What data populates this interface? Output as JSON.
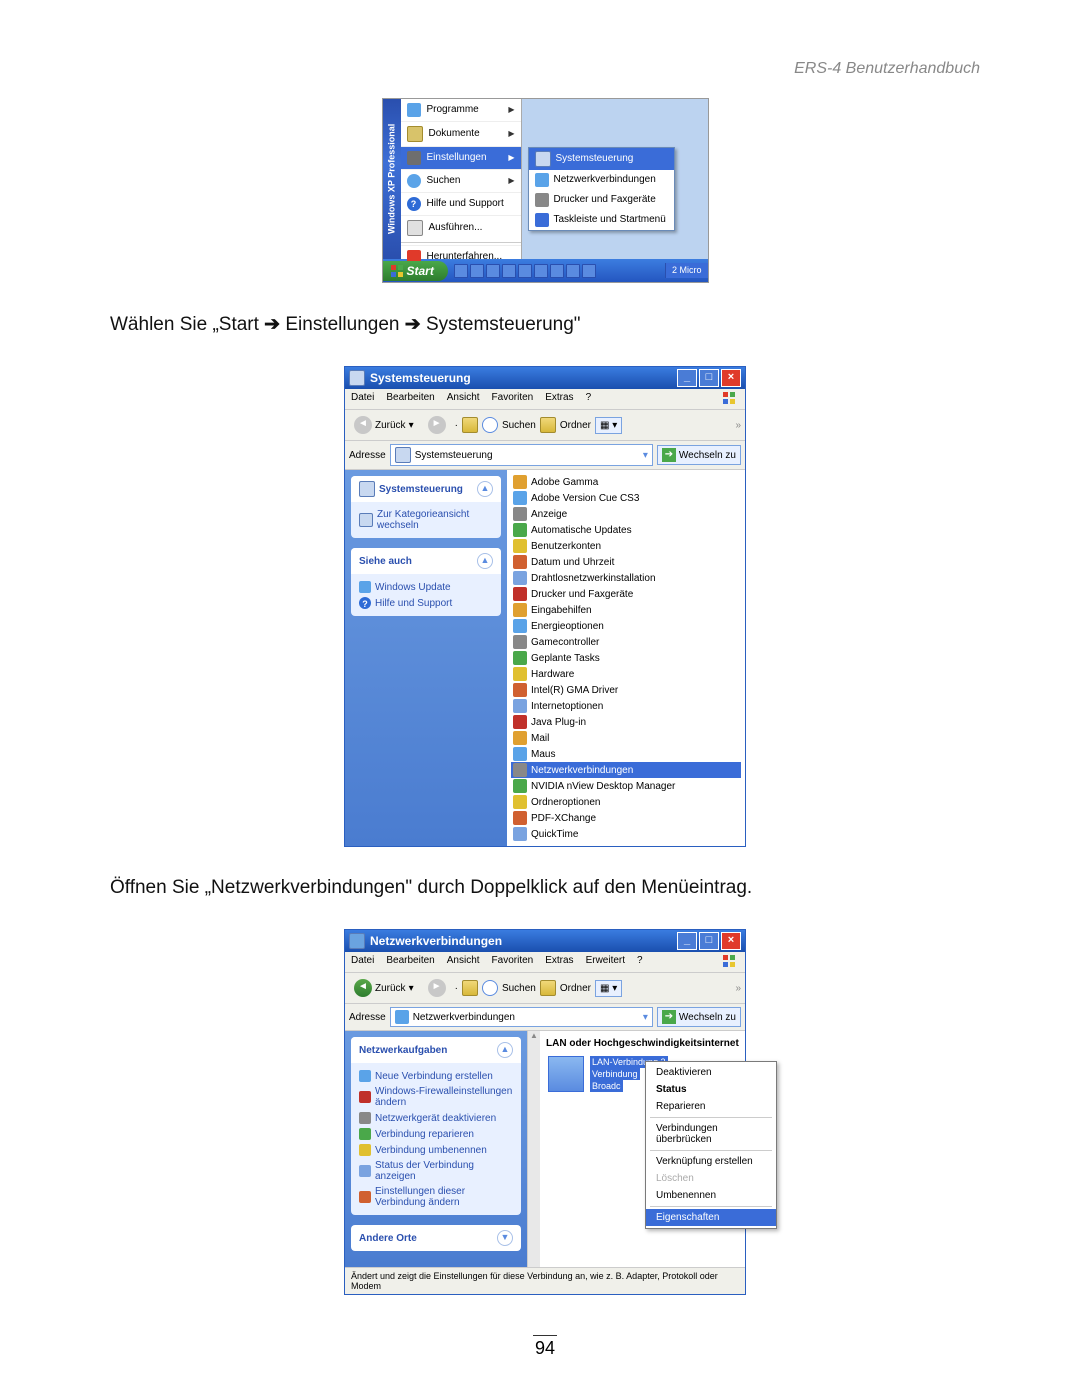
{
  "doc": {
    "header": "ERS-4  Benutzerhandbuch",
    "caption1_pre": "Wählen Sie „Start ",
    "caption1_mid": " Einstellungen ",
    "caption1_end": " Systemsteuerung\"",
    "caption2": "Öffnen Sie „Netzwerkverbindungen\" durch Doppelklick auf den Menüeintrag.",
    "page_number": "94",
    "arrow": "➔"
  },
  "shot1": {
    "xp_band": "Windows XP Professional",
    "menu": {
      "programme": "Programme",
      "dokumente": "Dokumente",
      "einstellungen": "Einstellungen",
      "suchen": "Suchen",
      "hilfe": "Hilfe und Support",
      "ausfuehren": "Ausführen...",
      "herunterfahren": "Herunterfahren..."
    },
    "submenu": {
      "systemsteuerung": "Systemsteuerung",
      "netzwerk": "Netzwerkverbindungen",
      "drucker": "Drucker und Faxgeräte",
      "taskleiste": "Taskleiste und Startmenü"
    },
    "taskbar": {
      "start": "Start",
      "right": "2 Micro"
    }
  },
  "shot2": {
    "title": "Systemsteuerung",
    "menubar": {
      "datei": "Datei",
      "bearbeiten": "Bearbeiten",
      "ansicht": "Ansicht",
      "favoriten": "Favoriten",
      "extras": "Extras",
      "hilfe": "?"
    },
    "toolbar": {
      "zurueck": "Zurück",
      "suchen": "Suchen",
      "ordner": "Ordner"
    },
    "addrbar": {
      "adresse": "Adresse",
      "value": "Systemsteuerung",
      "go": "Wechseln zu"
    },
    "panel1": {
      "head": "Systemsteuerung",
      "link": "Zur Kategorieansicht wechseln"
    },
    "panel2": {
      "head": "Siehe auch",
      "link1": "Windows Update",
      "link2": "Hilfe und Support"
    },
    "items": [
      "Adobe Gamma",
      "Adobe Version Cue CS3",
      "Anzeige",
      "Automatische Updates",
      "Benutzerkonten",
      "Datum und Uhrzeit",
      "Drahtlosnetzwerkinstallation",
      "Drucker und Faxgeräte",
      "Eingabehilfen",
      "Energieoptionen",
      "Gamecontroller",
      "Geplante Tasks",
      "Hardware",
      "Intel(R) GMA Driver",
      "Internetoptionen",
      "Java Plug-in",
      "Mail",
      "Maus",
      "Netzwerkverbindungen",
      "NVIDIA nView Desktop Manager",
      "Ordneroptionen",
      "PDF-XChange",
      "QuickTime"
    ],
    "selected_index": 18
  },
  "shot3": {
    "title": "Netzwerkverbindungen",
    "menubar": {
      "datei": "Datei",
      "bearbeiten": "Bearbeiten",
      "ansicht": "Ansicht",
      "favoriten": "Favoriten",
      "extras": "Extras",
      "erweitert": "Erweitert",
      "hilfe": "?"
    },
    "toolbar": {
      "zurueck": "Zurück",
      "suchen": "Suchen",
      "ordner": "Ordner"
    },
    "addrbar": {
      "adresse": "Adresse",
      "value": "Netzwerkverbindungen",
      "go": "Wechseln zu"
    },
    "panel1": {
      "head": "Netzwerkaufgaben",
      "links": [
        "Neue Verbindung erstellen",
        "Windows-Firewalleinstellungen ändern",
        "Netzwerkgerät deaktivieren",
        "Verbindung reparieren",
        "Verbindung umbenennen",
        "Status der Verbindung anzeigen",
        "Einstellungen dieser Verbindung ändern"
      ]
    },
    "panel2": {
      "head": "Andere Orte"
    },
    "section": "LAN oder Hochgeschwindigkeitsinternet",
    "lan": {
      "name": "LAN-Verbindung 2",
      "l2": "Verbindung",
      "l3": "Broadc"
    },
    "ctx": {
      "deaktivieren": "Deaktivieren",
      "status": "Status",
      "reparieren": "Reparieren",
      "ueberbruecken": "Verbindungen überbrücken",
      "verknuepfung": "Verknüpfung erstellen",
      "loeschen": "Löschen",
      "umbenennen": "Umbenennen",
      "eigenschaften": "Eigenschaften"
    },
    "statusbar": "Ändert und zeigt die Einstellungen für diese Verbindung an, wie z. B. Adapter, Protokoll oder Modem"
  }
}
